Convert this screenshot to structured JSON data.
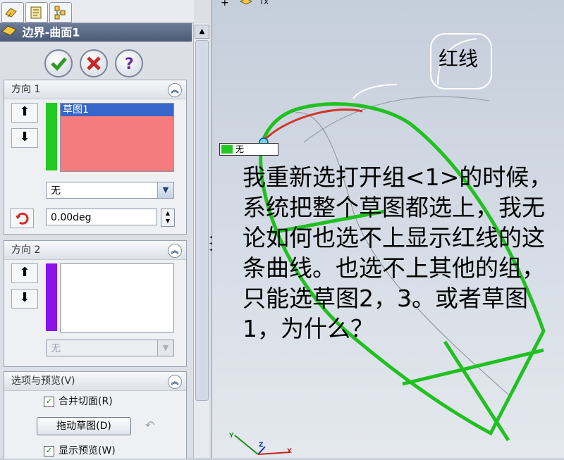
{
  "feature_panel": {
    "title": "边界-曲面1",
    "direction1": {
      "header": "方向 1",
      "selection": "草图1",
      "tangent_type": "无",
      "angle": "0.00deg"
    },
    "direction2": {
      "header": "方向 2",
      "tangent_type": "无"
    },
    "options": {
      "header": "选项与预览(V)",
      "merge_tangent": "合并切面(R)",
      "drag_sketch": "拖动草图(D)",
      "show_preview": "显示预览(W)"
    }
  },
  "viewport": {
    "callout_label": "无",
    "red_line_label": "红线",
    "annotation_text": "我重新选打开组<1>的时候，系统把整个草图都选上，我无论如何也选不上显示红线的这条曲线。也选不上其他的组，只能选草图2，3。或者草图1，为什么？",
    "triad": {
      "x": "X",
      "y": "Y",
      "z": "Z"
    },
    "top_marker": "TX"
  },
  "colors": {
    "direction1_bar": "#22c922",
    "direction2_bar": "#8a14e8",
    "selection_fill": "#f47c7c",
    "sketch_green": "#21c021",
    "red_curve": "#d1362a"
  }
}
